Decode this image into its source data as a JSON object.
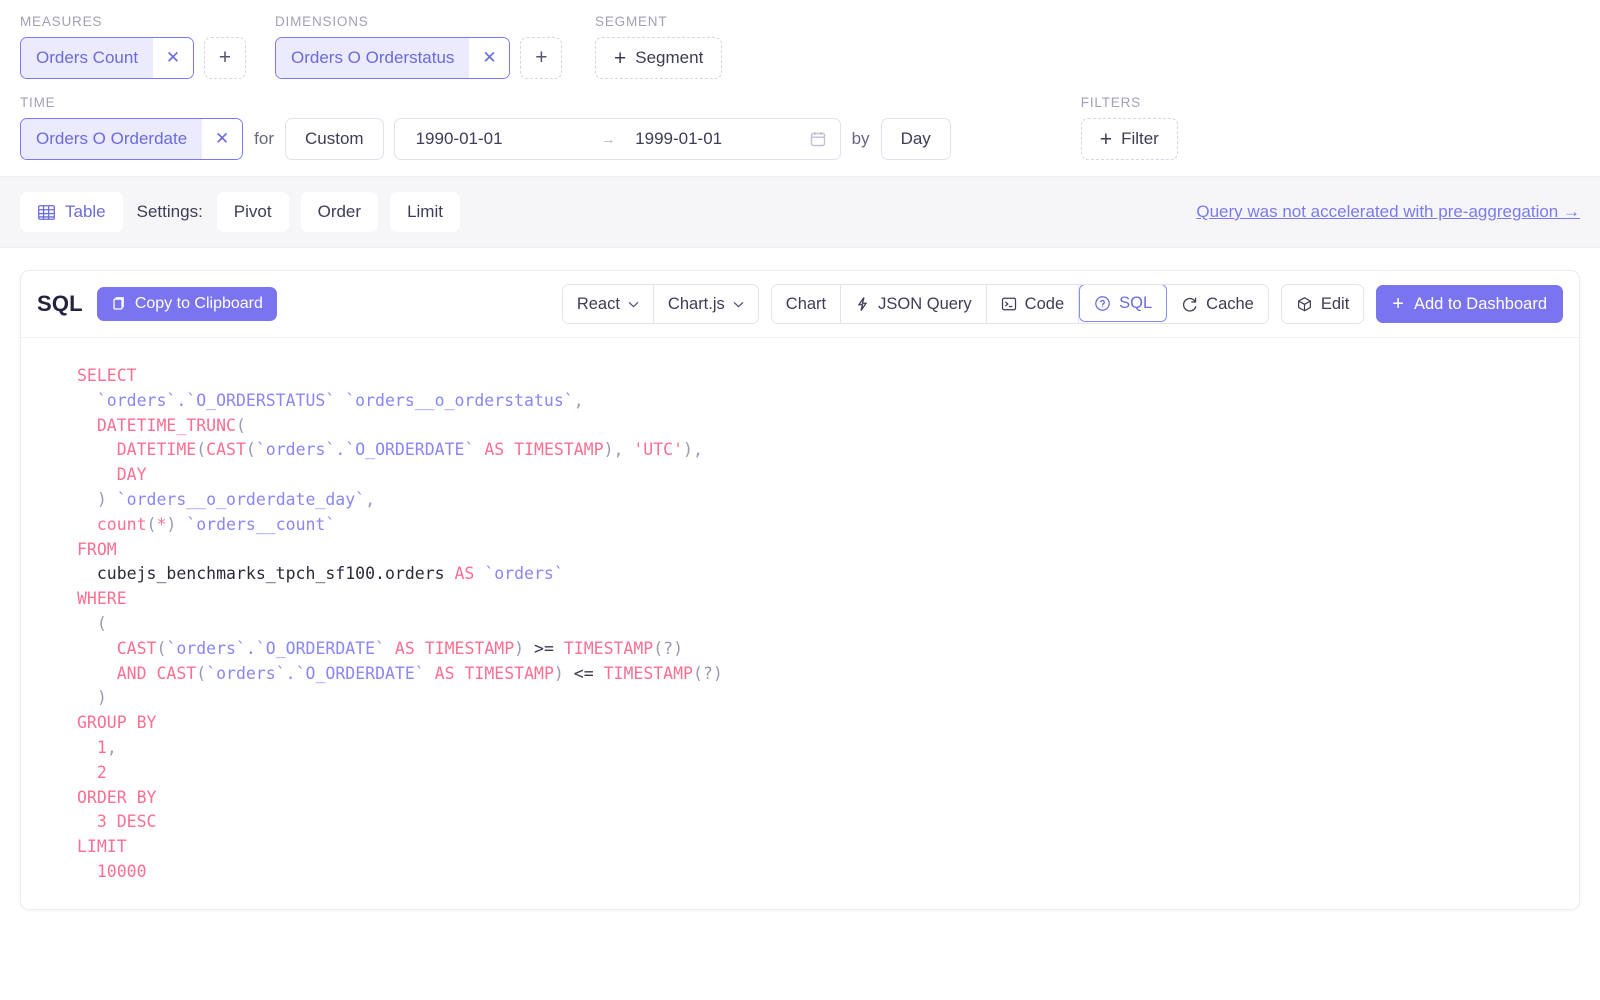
{
  "builder": {
    "measures": {
      "label": "MEASURES",
      "chips": [
        {
          "name": "Orders Count",
          "remove": "✕"
        }
      ],
      "add": "+"
    },
    "dimensions": {
      "label": "DIMENSIONS",
      "chips": [
        {
          "name": "Orders O Orderstatus",
          "remove": "✕"
        }
      ],
      "add": "+"
    },
    "segment": {
      "label": "SEGMENT",
      "add_plus": "+",
      "add_text": "Segment"
    },
    "time": {
      "label": "TIME",
      "chips": [
        {
          "name": "Orders O Orderdate",
          "remove": "✕"
        }
      ],
      "for_word": "for",
      "granularity_mode": "Custom",
      "date_from": "1990-01-01",
      "date_to": "1999-01-01",
      "range_separator": "→",
      "by_word": "by",
      "granularity": "Day"
    },
    "filters": {
      "label": "FILTERS",
      "add_plus": "+",
      "add_text": "Filter"
    }
  },
  "settings_bar": {
    "chart_type": "Table",
    "settings_label": "Settings:",
    "buttons": [
      "Pivot",
      "Order",
      "Limit"
    ],
    "accel_link": "Query was not accelerated with pre-aggregation →"
  },
  "sql_panel": {
    "title": "SQL",
    "copy_button": "Copy to Clipboard",
    "framework_select": "React",
    "library_select": "Chart.js",
    "chevron": "⌄",
    "tabs": [
      {
        "label": "Chart",
        "icon": "",
        "active": false
      },
      {
        "label": "JSON Query",
        "icon": "lightning-icon",
        "active": false
      },
      {
        "label": "Code",
        "icon": "terminal-icon",
        "active": false
      },
      {
        "label": "SQL",
        "icon": "question-circle-icon",
        "active": true
      },
      {
        "label": "Cache",
        "icon": "refresh-icon",
        "active": false
      }
    ],
    "edit_button": "Edit",
    "add_dashboard_button": "Add to Dashboard",
    "add_dashboard_plus": "+"
  },
  "sql_code": {
    "lines": [
      [
        {
          "t": "SELECT",
          "c": "k"
        }
      ],
      [
        {
          "t": "  ",
          "c": "pl"
        },
        {
          "t": "`orders`.`O_ORDERSTATUS` `orders__o_orderstatus`",
          "c": "id"
        },
        {
          "t": ",",
          "c": "pn"
        }
      ],
      [
        {
          "t": "  ",
          "c": "pl"
        },
        {
          "t": "DATETIME_TRUNC",
          "c": "k"
        },
        {
          "t": "(",
          "c": "pn"
        }
      ],
      [
        {
          "t": "    ",
          "c": "pl"
        },
        {
          "t": "DATETIME",
          "c": "k"
        },
        {
          "t": "(",
          "c": "pn"
        },
        {
          "t": "CAST",
          "c": "k"
        },
        {
          "t": "(",
          "c": "pn"
        },
        {
          "t": "`orders`.`O_ORDERDATE`",
          "c": "id"
        },
        {
          "t": " ",
          "c": "pl"
        },
        {
          "t": "AS TIMESTAMP",
          "c": "k"
        },
        {
          "t": "), ",
          "c": "pn"
        },
        {
          "t": "'UTC'",
          "c": "st"
        },
        {
          "t": "),",
          "c": "pn"
        }
      ],
      [
        {
          "t": "    ",
          "c": "pl"
        },
        {
          "t": "DAY",
          "c": "k"
        }
      ],
      [
        {
          "t": "  ",
          "c": "pl"
        },
        {
          "t": ") ",
          "c": "pn"
        },
        {
          "t": "`orders__o_orderdate_day`",
          "c": "id"
        },
        {
          "t": ",",
          "c": "pn"
        }
      ],
      [
        {
          "t": "  ",
          "c": "pl"
        },
        {
          "t": "count",
          "c": "k"
        },
        {
          "t": "(",
          "c": "pn"
        },
        {
          "t": "*",
          "c": "k"
        },
        {
          "t": ") ",
          "c": "pn"
        },
        {
          "t": "`orders__count`",
          "c": "id"
        }
      ],
      [
        {
          "t": "FROM",
          "c": "k"
        }
      ],
      [
        {
          "t": "  ",
          "c": "pl"
        },
        {
          "t": "cubejs_benchmarks_tpch_sf100.orders",
          "c": "pl"
        },
        {
          "t": " ",
          "c": "pl"
        },
        {
          "t": "AS",
          "c": "k"
        },
        {
          "t": " ",
          "c": "pl"
        },
        {
          "t": "`orders`",
          "c": "id"
        }
      ],
      [
        {
          "t": "WHERE",
          "c": "k"
        }
      ],
      [
        {
          "t": "  ",
          "c": "pl"
        },
        {
          "t": "(",
          "c": "pn"
        }
      ],
      [
        {
          "t": "    ",
          "c": "pl"
        },
        {
          "t": "CAST",
          "c": "k"
        },
        {
          "t": "(",
          "c": "pn"
        },
        {
          "t": "`orders`.`O_ORDERDATE`",
          "c": "id"
        },
        {
          "t": " ",
          "c": "pl"
        },
        {
          "t": "AS TIMESTAMP",
          "c": "k"
        },
        {
          "t": ") ",
          "c": "pn"
        },
        {
          "t": ">=",
          "c": "op"
        },
        {
          "t": " ",
          "c": "pl"
        },
        {
          "t": "TIMESTAMP",
          "c": "k"
        },
        {
          "t": "(?)",
          "c": "pn"
        }
      ],
      [
        {
          "t": "    ",
          "c": "pl"
        },
        {
          "t": "AND",
          "c": "k"
        },
        {
          "t": " ",
          "c": "pl"
        },
        {
          "t": "CAST",
          "c": "k"
        },
        {
          "t": "(",
          "c": "pn"
        },
        {
          "t": "`orders`.`O_ORDERDATE`",
          "c": "id"
        },
        {
          "t": " ",
          "c": "pl"
        },
        {
          "t": "AS TIMESTAMP",
          "c": "k"
        },
        {
          "t": ") ",
          "c": "pn"
        },
        {
          "t": "<=",
          "c": "op"
        },
        {
          "t": " ",
          "c": "pl"
        },
        {
          "t": "TIMESTAMP",
          "c": "k"
        },
        {
          "t": "(?)",
          "c": "pn"
        }
      ],
      [
        {
          "t": "  ",
          "c": "pl"
        },
        {
          "t": ")",
          "c": "pn"
        }
      ],
      [
        {
          "t": "GROUP BY",
          "c": "k"
        }
      ],
      [
        {
          "t": "  ",
          "c": "pl"
        },
        {
          "t": "1",
          "c": "nm"
        },
        {
          "t": ",",
          "c": "pn"
        }
      ],
      [
        {
          "t": "  ",
          "c": "pl"
        },
        {
          "t": "2",
          "c": "nm"
        }
      ],
      [
        {
          "t": "ORDER BY",
          "c": "k"
        }
      ],
      [
        {
          "t": "  ",
          "c": "pl"
        },
        {
          "t": "3 DESC",
          "c": "k"
        }
      ],
      [
        {
          "t": "LIMIT",
          "c": "k"
        }
      ],
      [
        {
          "t": "  ",
          "c": "pl"
        },
        {
          "t": "10000",
          "c": "nm"
        }
      ]
    ]
  }
}
